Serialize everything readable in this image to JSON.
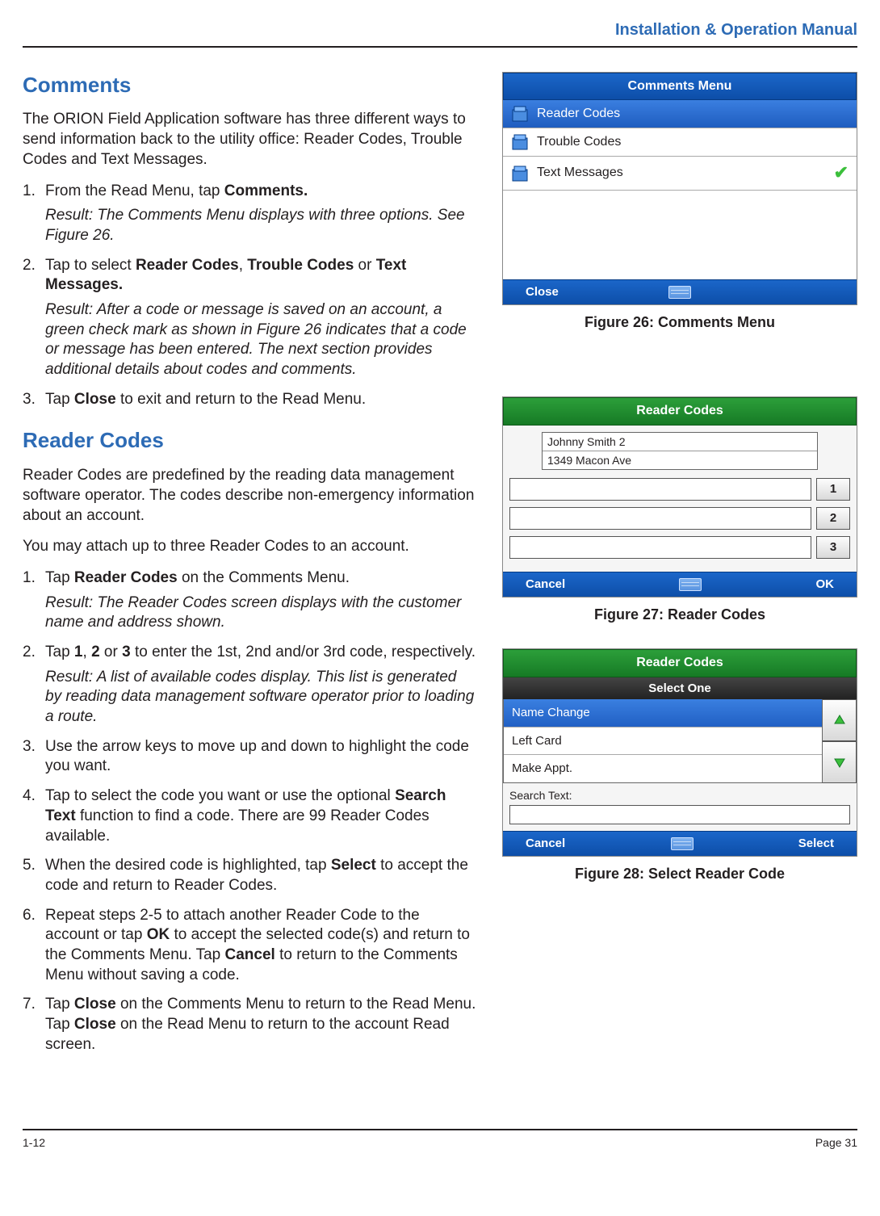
{
  "header": {
    "title": "Installation & Operation Manual"
  },
  "sections": {
    "comments": {
      "heading": "Comments",
      "intro": "The ORION Field Application software has three different ways to send information back to the utility office: Reader Codes, Trouble Codes and Text Messages.",
      "steps": [
        {
          "num": "1.",
          "pre": "From the Read Menu, tap ",
          "bold1": "Comments.",
          "result": "Result: The Comments Menu displays with three options. See Figure 26."
        },
        {
          "num": "2.",
          "pre": "Tap to select ",
          "bold1": "Reader Codes",
          "mid1": ", ",
          "bold2": "Trouble Codes",
          "mid2": " or ",
          "bold3": "Text Messages.",
          "result": "Result: After a code or message is saved on an account, a green check mark as shown in Figure 26 indicates that a code or message has been entered. The next section provides additional details about codes and comments."
        },
        {
          "num": "3.",
          "pre": "Tap ",
          "bold1": "Close",
          "post": " to exit and return to the Read Menu."
        }
      ]
    },
    "readerCodes": {
      "heading": "Reader Codes",
      "intro1": "Reader Codes are predefined by the reading data management software operator. The codes describe non-emergency information about an account.",
      "intro2": "You may attach up to three Reader Codes to an account.",
      "steps": [
        {
          "num": "1.",
          "pre": "Tap ",
          "bold1": "Reader Codes",
          "post": " on the Comments Menu.",
          "result": "Result: The Reader Codes screen displays with the customer name and address shown."
        },
        {
          "num": "2.",
          "pre": "Tap ",
          "bold1": "1",
          "mid1": ", ",
          "bold2": "2",
          "mid2": " or ",
          "bold3": "3",
          "post": " to enter the 1st, 2nd and/or 3rd code, respectively.",
          "result": "Result: A list of available codes display. This list is generated by reading data management software operator prior to loading a route."
        },
        {
          "num": "3.",
          "text": "Use the arrow keys to move up and down to highlight the code you want."
        },
        {
          "num": "4.",
          "pre": "Tap to select the code you want or use the optional ",
          "bold1": "Search Text",
          "post": " function to find a code. There are 99 Reader Codes available."
        },
        {
          "num": "5.",
          "pre": "When the desired code is highlighted, tap ",
          "bold1": "Select",
          "post": " to accept the code and return to Reader Codes."
        },
        {
          "num": "6.",
          "pre": "Repeat steps 2-5 to attach another Reader Code to the account or tap ",
          "bold1": "OK",
          "mid1": " to accept the selected code(s) and return to the Comments Menu. Tap ",
          "bold2": "Cancel",
          "post": " to return to the Comments Menu without saving a code."
        },
        {
          "num": "7.",
          "pre": "Tap ",
          "bold1": "Close",
          "mid1": " on the Comments Menu to return to the Read Menu. Tap ",
          "bold2": "Close",
          "post": " on the Read Menu to return to the account Read screen."
        }
      ]
    }
  },
  "figures": {
    "fig26": {
      "caption": "Figure 26:  Comments Menu",
      "title": "Comments Menu",
      "rows": [
        "Reader Codes",
        "Trouble Codes",
        "Text Messages"
      ],
      "close": "Close"
    },
    "fig27": {
      "caption": "Figure 27:  Reader Codes",
      "title": "Reader Codes",
      "customer": "Johnny Smith 2",
      "address": "1349 Macon Ave",
      "buttons": [
        "1",
        "2",
        "3"
      ],
      "cancel": "Cancel",
      "ok": "OK"
    },
    "fig28": {
      "caption": "Figure 28:  Select Reader Code",
      "title": "Reader Codes",
      "subtitle": "Select One",
      "items": [
        "Name Change",
        "Left Card",
        "Make Appt."
      ],
      "searchLabel": "Search Text:",
      "cancel": "Cancel",
      "select": "Select"
    }
  },
  "footer": {
    "left": "1-12",
    "right": "Page 31"
  }
}
